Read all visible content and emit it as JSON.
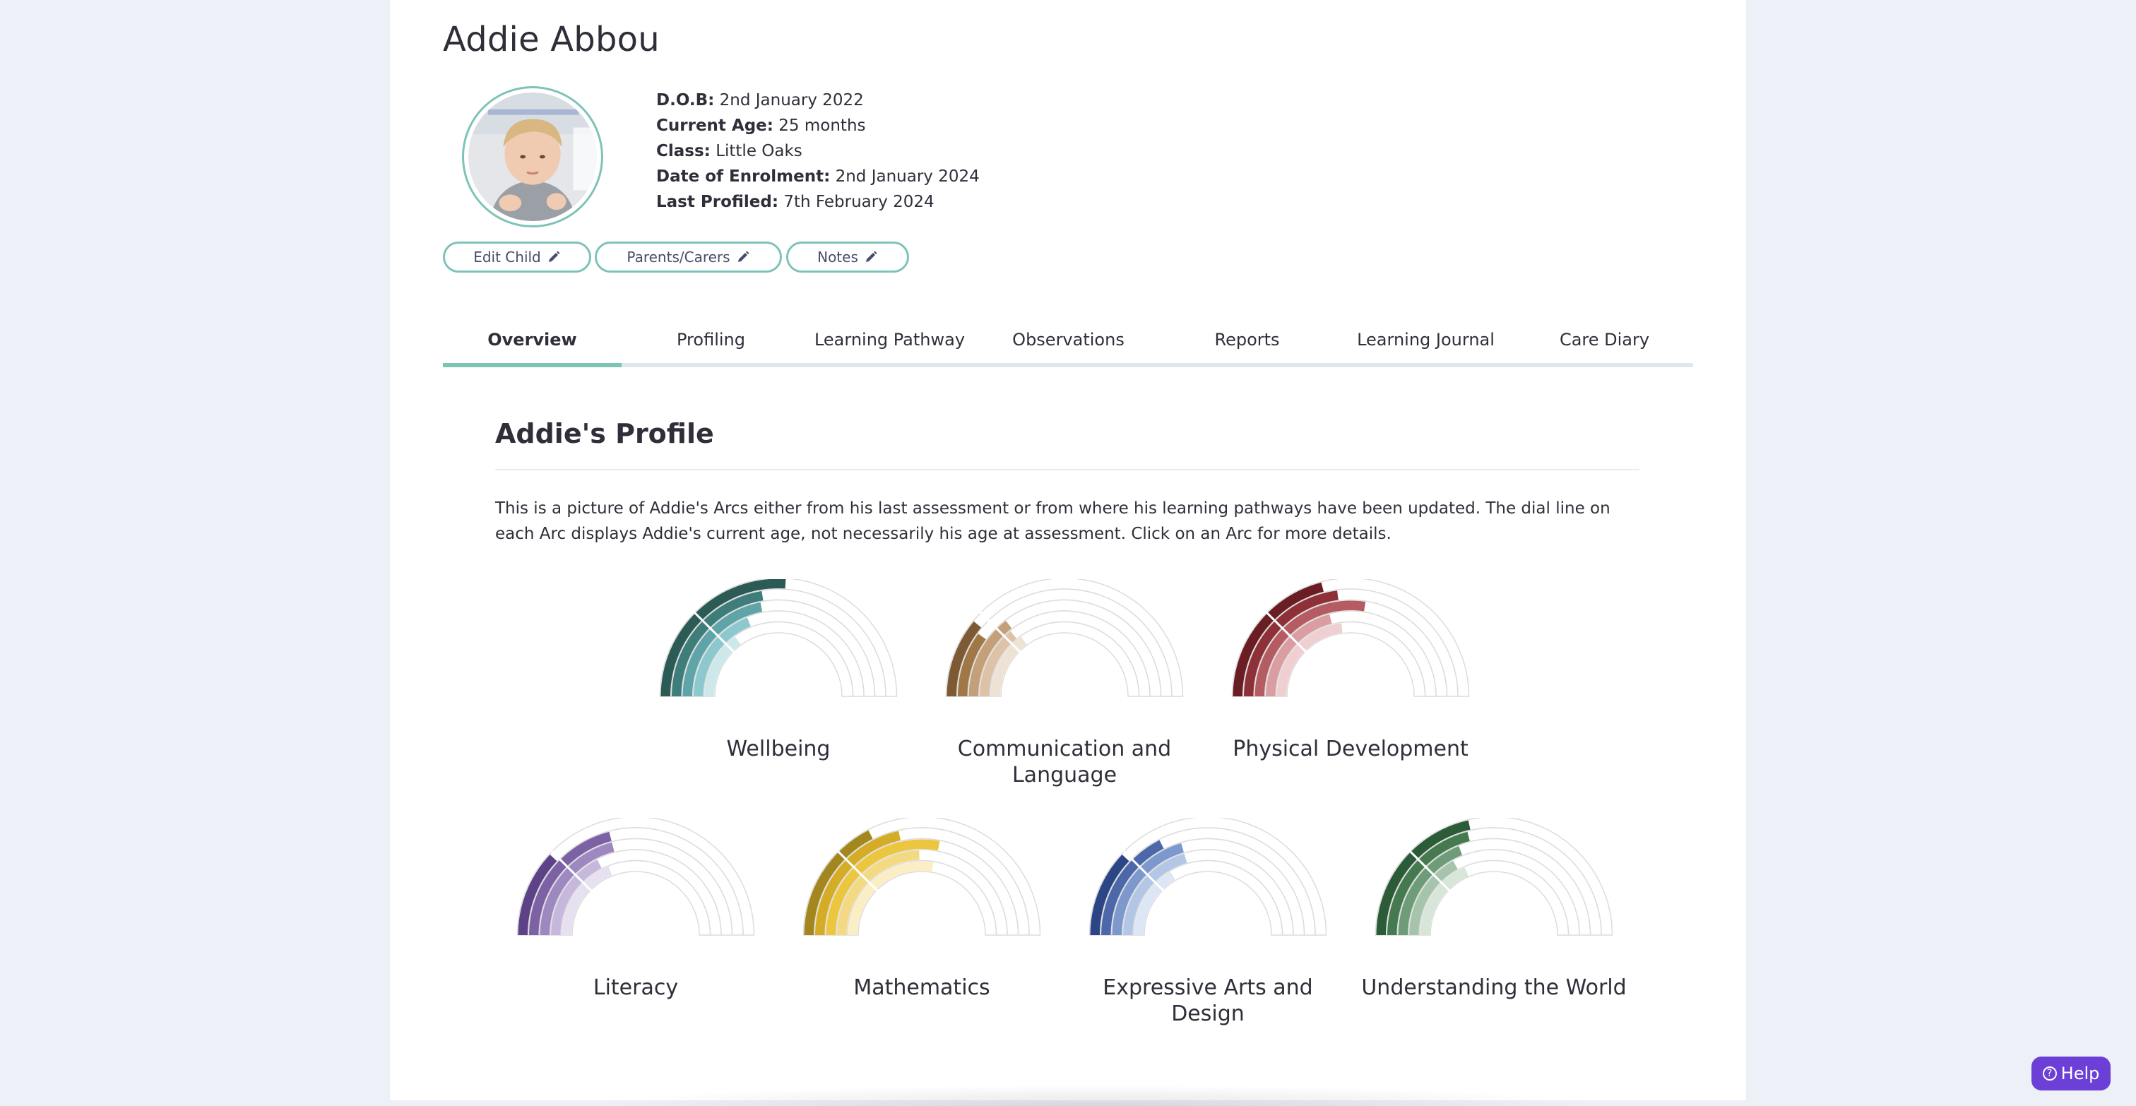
{
  "child": {
    "name": "Addie Abbou",
    "details": [
      {
        "label": "D.O.B:",
        "value": "2nd January 2022"
      },
      {
        "label": "Current Age:",
        "value": "25 months"
      },
      {
        "label": "Class:",
        "value": "Little Oaks"
      },
      {
        "label": "Date of Enrolment:",
        "value": "2nd January 2024"
      },
      {
        "label": "Last Profiled:",
        "value": "7th February 2024"
      }
    ]
  },
  "actions": {
    "edit_child": "Edit Child",
    "parents_carers": "Parents/Carers",
    "notes": "Notes"
  },
  "tabs": [
    "Overview",
    "Profiling",
    "Learning Pathway",
    "Observations",
    "Reports",
    "Learning Journal",
    "Care Diary"
  ],
  "active_tab": "Overview",
  "profile": {
    "title": "Addie's Profile",
    "description": "This is a picture of Addie's Arcs either from his last assessment or from where his learning pathways have been updated. The dial line on each Arc displays Addie's current age, not necessarily his age at assessment. Click on an Arc for more details."
  },
  "arcs": [
    {
      "label": "Wellbeing",
      "colors": [
        "#2c5a55",
        "#3f7d7a",
        "#5ea4a8",
        "#8cc8cd",
        "#cce8ea"
      ],
      "levels": [
        0.52,
        0.45,
        0.44,
        0.38,
        0.3
      ]
    },
    {
      "label": "Communication and Language",
      "colors": [
        "#7d5a34",
        "#a07848",
        "#c3a07a",
        "#dcc3a8",
        "#eee2d4"
      ],
      "levels": [
        0.22,
        0.2,
        0.29,
        0.28,
        0.3
      ]
    },
    {
      "label": "Physical Development",
      "colors": [
        "#6a1e24",
        "#8e3038",
        "#b55b62",
        "#d99da2",
        "#efcfd1"
      ],
      "levels": [
        0.42,
        0.46,
        0.55,
        0.42,
        0.46
      ]
    },
    {
      "label": "Literacy",
      "colors": [
        "#5e4287",
        "#7c62a4",
        "#9e88c0",
        "#c6b8dc",
        "#e6e0f0"
      ],
      "levels": [
        0.24,
        0.42,
        0.42,
        0.35,
        0.38
      ]
    },
    {
      "label": "Mathematics",
      "colors": [
        "#a3871e",
        "#d4ac25",
        "#ecc63f",
        "#f4d983",
        "#fbeec5"
      ],
      "levels": [
        0.35,
        0.43,
        0.56,
        0.49,
        0.55
      ]
    },
    {
      "label": "Expressive Arts and Design",
      "colors": [
        "#2c4585",
        "#4c68a8",
        "#7d98cc",
        "#b3c6e6",
        "#dde6f4"
      ],
      "levels": [
        0.24,
        0.35,
        0.41,
        0.41,
        0.33
      ]
    },
    {
      "label": "Understanding the World",
      "colors": [
        "#2c5b38",
        "#457a50",
        "#6e9c78",
        "#a6c4ac",
        "#d6e6d8"
      ],
      "levels": [
        0.43,
        0.42,
        0.38,
        0.34,
        0.37
      ]
    }
  ],
  "help": {
    "label": "Help",
    "icon": "question-circle-icon"
  }
}
